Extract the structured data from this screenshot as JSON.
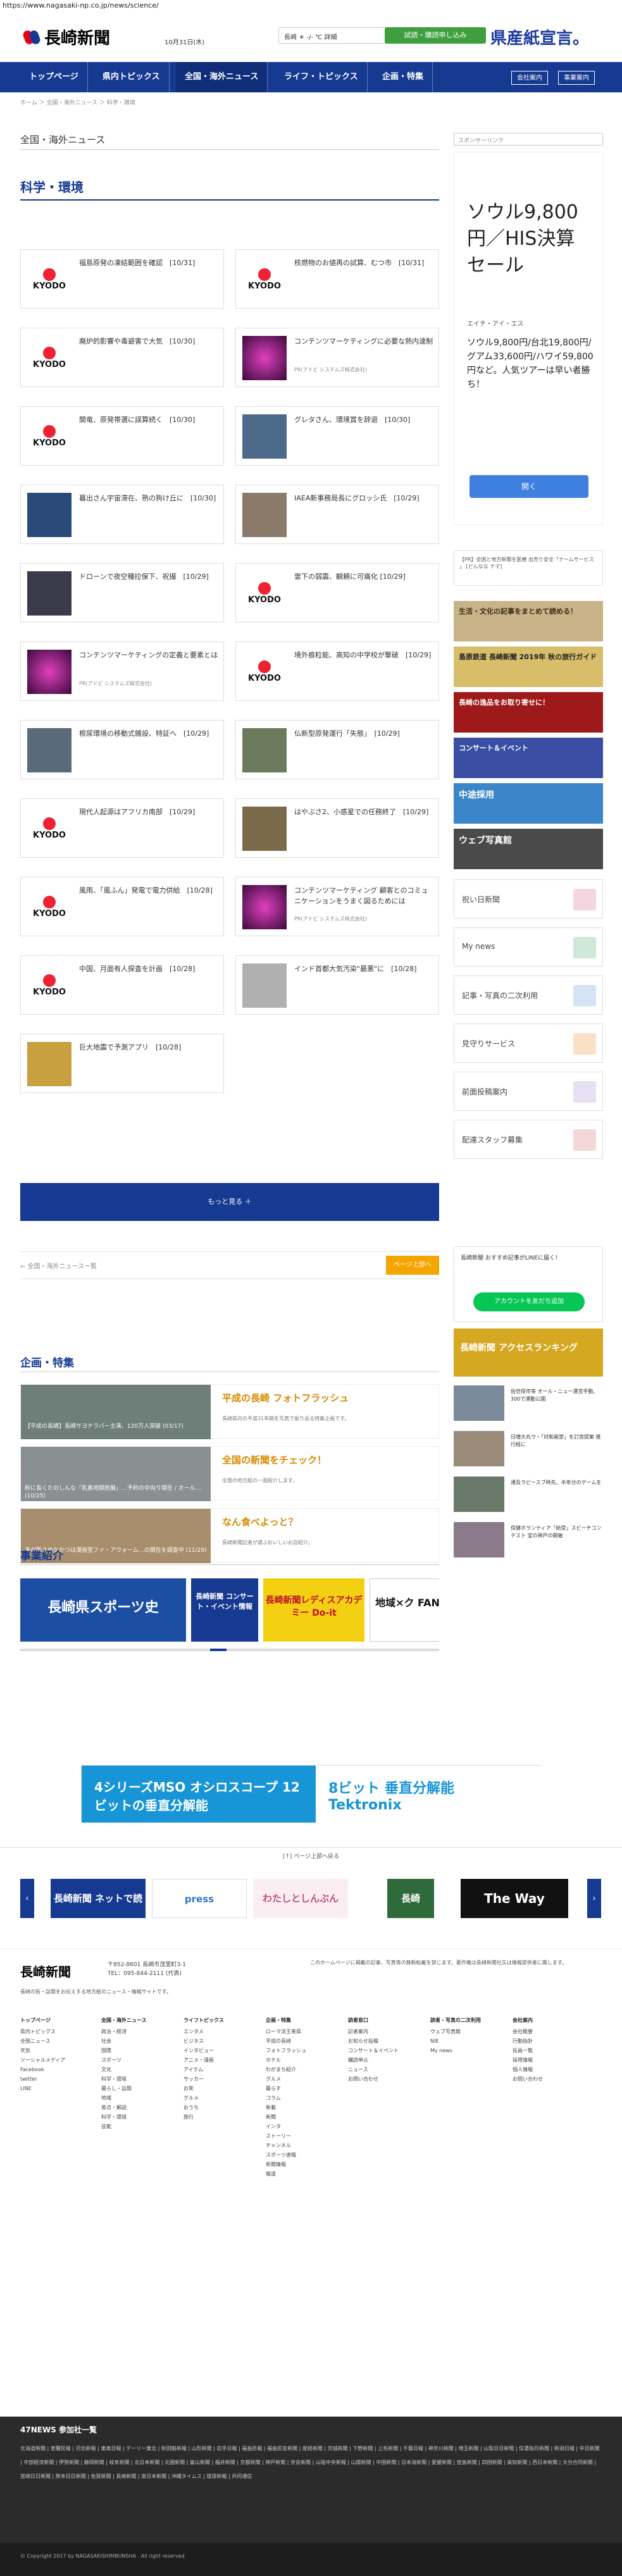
{
  "url": "https://www.nagasaki-np.co.jp/news/science/",
  "header": {
    "logo": "長崎新聞",
    "date": "10月31日(木)",
    "weather": "長崎 ☀ -/- ℃ 詳細",
    "trial": "試読・購読申し込み",
    "kenpo": "県産紙宣言。"
  },
  "nav": {
    "items": [
      "トップページ",
      "県内トピックス",
      "全国・海外ニュース",
      "ライフ・トピックス",
      "企画・特集"
    ],
    "subs": [
      "会社案内",
      "事業案内"
    ]
  },
  "breadcrumb": "ホーム ＞ 全国・海外ニュース ＞ 科学・環境",
  "section": {
    "label": "全国・海外ニュース",
    "title": "科学・環境"
  },
  "articles": [
    {
      "t": "福島原発の凍結範囲を確認　[10/31]",
      "img": "kyodo"
    },
    {
      "t": "核燃物のお値再の試算、むつ市　[10/31]",
      "img": "kyodo"
    },
    {
      "t": "廃炉的影響や毒避害で大気　[10/30]",
      "img": "kyodo"
    },
    {
      "t": "コンテンツマーケティングに必要な熱内達制",
      "img": "pink",
      "src": "PR(アドビ システムズ株式会社)"
    },
    {
      "t": "開竜、原発帯選に誤算続く　[10/30]",
      "img": "kyodo"
    },
    {
      "t": "グレタさん、環境賞を辞退　[10/30]",
      "img": "photo1"
    },
    {
      "t": "暮出さん宇宙滞在、熟の狗け丘に　[10/30]",
      "img": "astro"
    },
    {
      "t": "IAEA新事務局長にグロッシ氏　[10/29]",
      "img": "photo2"
    },
    {
      "t": "ドローンで夜空種拉保下、祝撮　[10/29]",
      "img": "photo3"
    },
    {
      "t": "雲下の弱震、観頼に可痛化 [10/29]",
      "img": "kyodo"
    },
    {
      "t": "コンテンツマーケティングの定義と要素とは",
      "img": "pink",
      "src": "PR(アドビ システムズ株式会社)"
    },
    {
      "t": "境外痕粒能、高知の中学校が撃破　[10/29]",
      "img": "kyodo"
    },
    {
      "t": "根尿環境の移動式雑設、特証へ　[10/29]",
      "img": "photo4"
    },
    {
      "t": "仏新型原発運行「失態」　[10/29]",
      "img": "photo5"
    },
    {
      "t": "現代人起源はアフリカ南部　[10/29]",
      "img": "kyodo"
    },
    {
      "t": "はやぶさ2、小惑星での任務終了　[10/29]",
      "img": "space"
    },
    {
      "t": "風雨、「風ふん」発電で電力供給　[10/28]",
      "img": "kyodo"
    },
    {
      "t": "コンテンツマーケティング 顧客とのコミュニケーションをうまく図るためには",
      "img": "pink",
      "src": "PR(アドビ システムズ株式会社)"
    },
    {
      "t": "中国、月面有人探査を計画　[10/28]",
      "img": "kyodo"
    },
    {
      "t": "インド首都大気汚染\"最悪\"に　[10/28]",
      "img": "photo6"
    },
    {
      "t": "巨大地震で予測アプリ　[10/28]",
      "img": "app"
    }
  ],
  "more": "もっと見る ＋",
  "pager": {
    "prev": "← 全国・海外ニュース一覧",
    "next": "ページ上部へ"
  },
  "kikaku": {
    "title": "企画・特集",
    "rows": [
      {
        "cap": "【平成の長崎】長崎サヨナラバー主演、120万人突破 (03/17)",
        "title": "平成の長崎 フォトフラッシュ",
        "desc": "長崎県内の平成31年間を写真で振り返る特集企画です。"
      },
      {
        "cap": "秋に長くたのしんな「乳素地開放展」…予約の中向り開在 / オール… (10/25)",
        "title": "全国の新聞をチェック！",
        "desc": "全国の地方紙の一面紹介します。"
      },
      {
        "cap": "身が新さめなかつは漫画堂ファ・アウォーム…の開在を調査中 (11/29)",
        "title": "なん食べよっと？",
        "desc": "長崎新聞記者が選ぶおいしいお店紹介。"
      }
    ]
  },
  "jigyo": {
    "title": "事業紹介",
    "items": [
      "長崎県スポーツ史",
      "長崎新聞 コンサート・イベント情報",
      "長崎新聞レディスアカデミー Do-it",
      "地域×ク FAN"
    ]
  },
  "side": {
    "sponsor": "スポンサーリンク",
    "ad": {
      "big": "ソウル9,800円／HIS決算セール",
      "co": "エイチ・アイ・エス",
      "body": "ソウル9,800円/台北19,800円/グアム33,600円/ハワイ59,800円など。人気ツアーは早い者勝ち！",
      "open": "開く"
    },
    "note": "【PR】全国と地方新聞を医療 出売り安全「ナームサービス 」 [どんなな ナマ]",
    "banners": [
      "生活・文化の記事をまとめて読める！",
      "島原鉄道 長崎新聞 2019年 秋の旅行ガイド",
      "長崎の逸品をお取り寄せに！",
      "コンサート＆イベント",
      "中途採用",
      "ウェブ写真館"
    ],
    "services": [
      "祝い日新聞",
      "My news",
      "記事・写真の二次利用",
      "見守りサービス",
      "前面投稿案内",
      "配達スタッフ募集"
    ],
    "line": {
      "txt": "長崎新聞 おすすめ記事がLINEに届く！",
      "btn": "アカウントを友だち追加"
    },
    "rank": "長崎新聞 アクセスランキング",
    "news": [
      "佐世保市等 オール・ニュー運営手動、300で運動公園",
      "日増大丸ウ・「対和画堂」を訂宮提案 推行経に",
      "通及ラピースブ時先、半年分のゲームを",
      "保健ボランティア「給受」スビーチコンテスト 宝の神戸の開催"
    ]
  },
  "bottomAd": {
    "l": "4シリーズMSO オシロスコープ 12ビットの垂直分解能",
    "r": "8ビット 垂直分解能 Tektronix"
  },
  "toTop": "[↑] ページ上部へ戻る",
  "carousel": [
    "長崎新聞 ネットで読む",
    "press",
    "わたしとしんぶん",
    "長崎",
    "The Way"
  ],
  "footer": {
    "logo": "長崎新聞",
    "addr": "〒852-8601 長崎市茂里町3-1\nTEL：095-844-2111 (代表)",
    "note": "このホームページに掲載の記事、写真等の無断転載を禁じます。著作権は長崎新聞社又は情報提供者に属します。",
    "tag": "長崎の街・話題をお伝えする地方紙のニュース・情報サイトです。",
    "cols": [
      {
        "h": "トップページ",
        "items": [
          "県内トピックス",
          "全国ニュース",
          "天気",
          "ソーシャルメディア",
          "Facebook",
          "twitter",
          "LINE"
        ]
      },
      {
        "h": "全国・海外ニュース",
        "items": [
          "政治・経済",
          "社会",
          "国際",
          "スポーツ",
          "文化",
          "科学・環境",
          "暮らし・話題",
          "地域",
          "焦点・解説",
          "科学・環境",
          "芸能"
        ]
      },
      {
        "h": "ライフトピックス",
        "items": [
          "エンタメ",
          "ビジネス",
          "インタビュー",
          "アニメ・漫画",
          "アイテム",
          "サッカー",
          "お笑",
          "グルメ",
          "おうち",
          "旅行"
        ]
      },
      {
        "h": "企画・特集",
        "items": [
          "ローマ法王来県",
          "平成の長崎",
          "フォトフラッシュ",
          "ホテル",
          "わがまち紹介",
          "グルメ",
          "暮らす",
          "コラム",
          "新着",
          "新聞",
          "インタ",
          "ストーリー",
          "チャンネル",
          "スポーツ速報",
          "新聞情報",
          "報道"
        ]
      },
      {
        "h": "読者窓口",
        "items": [
          "記者案内",
          "お知らせ投稿",
          "コンサート＆イベント",
          "購読申込",
          "ニュース",
          "お問い合わせ"
        ]
      },
      {
        "h": "読者・写真の二次利用",
        "items": [
          "ウェブ写真館",
          "NIE",
          "My news"
        ]
      },
      {
        "h": "会社案内",
        "items": [
          "会社概要",
          "行動指針",
          "役員一覧",
          "採用情報",
          "個人情報",
          "お問い合わせ"
        ]
      }
    ]
  },
  "news47": {
    "title": "47NEWS 参加社一覧",
    "list": "北海道新聞 | 室蘭民報 | 河北新報 | 東奥日報 | デーリー東北 | 秋田魁新報 | 山形新聞 | 岩手日報 | 福島民報 | 福島民友新聞 | 産経新聞 | 茨城新聞 | 下野新聞 | 上毛新聞 | 千葉日報 | 神奈川新聞 | 埼玉新聞 | 山梨日日新聞 | 信濃毎日新聞 | 新潟日報 | 中日新聞 | 中部経済新聞 | 伊勢新聞 | 静岡新聞 | 岐阜新聞 | 北日本新聞 | 北國新聞 | 富山新聞 | 福井新聞 | 京都新聞 | 神戸新聞 | 奈良新聞 | 山陰中央新報 | 山陽新聞 | 中国新聞 | 日本海新聞 | 愛媛新聞 | 徳島新聞 | 四国新聞 | 高知新聞 | 西日本新聞 | 大分合同新聞 | 宮崎日日新聞 | 熊本日日新聞 | 佐賀新聞 | 長崎新聞 | 南日本新聞 | 沖縄タイムス | 琉球新報 | 共同通信"
  },
  "copyright": "© Copyright 2017 by NAGASAKISHIMBUNSHA . All right reserved"
}
